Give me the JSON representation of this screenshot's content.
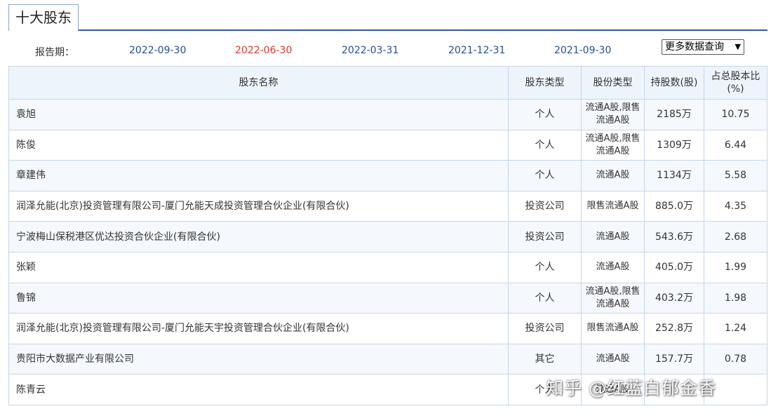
{
  "tab": {
    "title": "十大股东"
  },
  "period": {
    "label": "报告期：",
    "dates": [
      {
        "label": "2022-09-30",
        "active": false
      },
      {
        "label": "2022-06-30",
        "active": true
      },
      {
        "label": "2022-03-31",
        "active": false
      },
      {
        "label": "2021-12-31",
        "active": false
      },
      {
        "label": "2021-09-30",
        "active": false
      }
    ],
    "more_select": "更多数据查询"
  },
  "table": {
    "headers": {
      "name": "股东名称",
      "holder_type": "股东类型",
      "share_type": "股份类型",
      "shares": "持股数(股)",
      "ratio": "占总股本比(%)"
    },
    "rows": [
      {
        "name": "袁旭",
        "holder_type": "个人",
        "share_type": "流通A股,限售流通A股",
        "shares": "2185万",
        "ratio": "10.75"
      },
      {
        "name": "陈俊",
        "holder_type": "个人",
        "share_type": "流通A股,限售流通A股",
        "shares": "1309万",
        "ratio": "6.44"
      },
      {
        "name": "章建伟",
        "holder_type": "个人",
        "share_type": "流通A股",
        "shares": "1134万",
        "ratio": "5.58"
      },
      {
        "name": "润泽允能(北京)投资管理有限公司-厦门允能天成投资管理合伙企业(有限合伙)",
        "holder_type": "投资公司",
        "share_type": "限售流通A股",
        "shares": "885.0万",
        "ratio": "4.35"
      },
      {
        "name": "宁波梅山保税港区优达投资合伙企业(有限合伙)",
        "holder_type": "投资公司",
        "share_type": "流通A股",
        "shares": "543.6万",
        "ratio": "2.68"
      },
      {
        "name": "张颖",
        "holder_type": "个人",
        "share_type": "流通A股",
        "shares": "405.0万",
        "ratio": "1.99"
      },
      {
        "name": "鲁锦",
        "holder_type": "个人",
        "share_type": "流通A股,限售流通A股",
        "shares": "403.2万",
        "ratio": "1.98"
      },
      {
        "name": "润泽允能(北京)投资管理有限公司-厦门允能天宇投资管理合伙企业(有限合伙)",
        "holder_type": "投资公司",
        "share_type": "限售流通A股",
        "shares": "252.8万",
        "ratio": "1.24"
      },
      {
        "name": "贵阳市大数据产业有限公司",
        "holder_type": "其它",
        "share_type": "流通A股",
        "shares": "157.7万",
        "ratio": "0.78"
      },
      {
        "name": "陈青云",
        "holder_type": "个人",
        "share_type": "流通A股",
        "shares": "",
        "ratio": ""
      }
    ]
  },
  "watermark": "知乎 @红蓝白郁金香",
  "colors": {
    "active_date": "#e0352b",
    "date_link": "#1f4e9a",
    "header_bg": "#eef4fb",
    "accent": "#2a5d9f"
  }
}
